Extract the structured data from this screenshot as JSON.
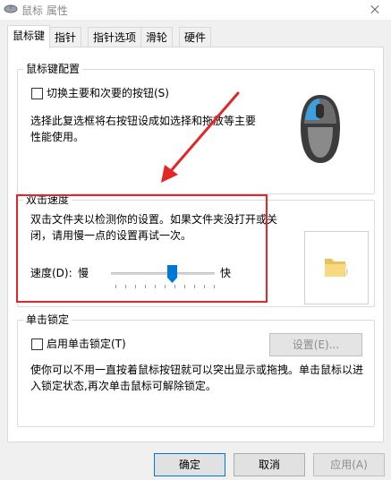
{
  "window": {
    "title": "鼠标 属性"
  },
  "tabs": [
    {
      "label": "鼠标键",
      "active": true
    },
    {
      "label": "指针"
    },
    {
      "label": "指针选项"
    },
    {
      "label": "滑轮"
    },
    {
      "label": "硬件"
    }
  ],
  "button_config": {
    "group_title": "鼠标键配置",
    "switch_label": "切换主要和次要的按钮(S)",
    "switch_checked": false,
    "description_line1": "选择此复选框将右按钮设成如选择和拖放等主要",
    "description_line2": "性能使用。",
    "mouse_icon": "mouse-icon"
  },
  "double_click": {
    "group_title": "双击速度",
    "description_line1": "双击文件夹以检测你的设置。如果文件夹没打开或关",
    "description_line2": "闭，请用慢一点的设置再试一次。",
    "speed_label": "速度(D):",
    "slow_label": "慢",
    "fast_label": "快",
    "speed_fraction": 0.6,
    "test_icon": "folder-icon"
  },
  "click_lock": {
    "group_title": "单击锁定",
    "enable_label": "启用单击锁定(T)",
    "enable_checked": false,
    "settings_button": "设置(E)...",
    "description_line1": "使你可以不用一直按着鼠标按钮就可以突出显示或拖拽。单击鼠标以进",
    "description_line2": "入锁定状态,再次单击鼠标可解除锁定。"
  },
  "footer": {
    "ok": "确定",
    "cancel": "取消",
    "apply": "应用(A)"
  },
  "colors": {
    "accent": "#0078d7",
    "annotation": "#e32727"
  }
}
